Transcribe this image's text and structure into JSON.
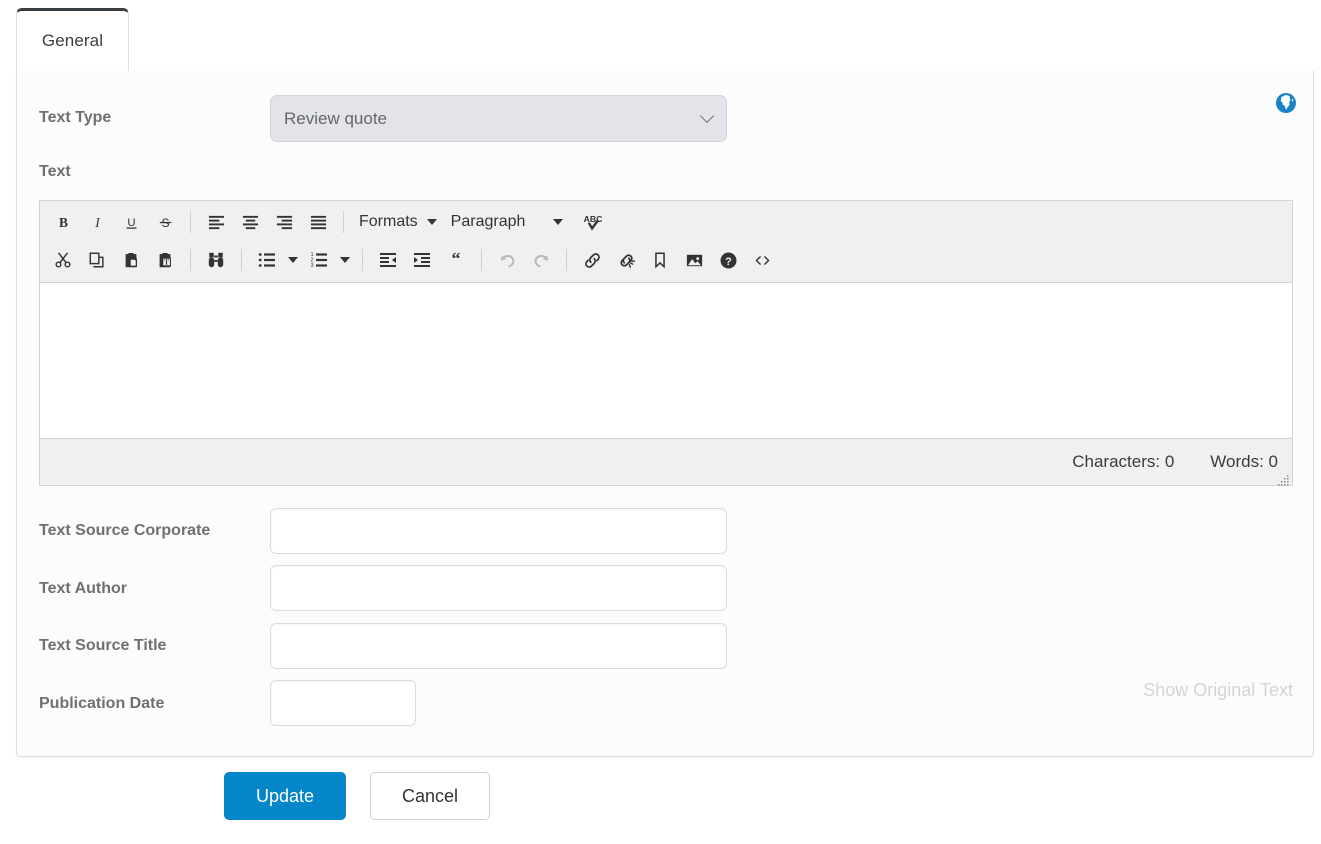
{
  "tabs": [
    {
      "id": "general",
      "label": "General",
      "active": true
    }
  ],
  "colors": {
    "accent": "#0586c8",
    "tab_active_top": "#3a3f44",
    "label": "#707070",
    "select_bg": "#e3e4ea",
    "toolbar_bg": "#f0f0f0",
    "muted_link": "#d4d4d4",
    "globe": "#1a83c6"
  },
  "form": {
    "text_type": {
      "label": "Text Type",
      "value": "Review quote",
      "icon": "chevron-down-icon"
    },
    "text": {
      "label": "Text"
    },
    "text_source_corporate": {
      "label": "Text Source Corporate",
      "value": "",
      "placeholder": ""
    },
    "text_author": {
      "label": "Text Author",
      "value": "",
      "placeholder": ""
    },
    "text_source_title": {
      "label": "Text Source Title",
      "value": "",
      "placeholder": ""
    },
    "publication_date": {
      "label": "Publication Date",
      "value": "",
      "placeholder": ""
    }
  },
  "language_button": {
    "icon": "globe-icon",
    "title": "Globe"
  },
  "editor": {
    "toolbar_row1": [
      {
        "name": "bold-icon",
        "label": "B",
        "kind": "icon"
      },
      {
        "name": "italic-icon",
        "label": "I",
        "kind": "icon"
      },
      {
        "name": "underline-icon",
        "label": "U",
        "kind": "icon"
      },
      {
        "name": "strikethrough-icon",
        "label": "S",
        "kind": "icon"
      },
      {
        "name": "separator",
        "kind": "sep"
      },
      {
        "name": "align-left-icon",
        "kind": "icon"
      },
      {
        "name": "align-center-icon",
        "kind": "icon"
      },
      {
        "name": "align-right-icon",
        "kind": "icon"
      },
      {
        "name": "align-justify-icon",
        "kind": "icon"
      },
      {
        "name": "separator",
        "kind": "sep"
      },
      {
        "name": "formats-menu",
        "label": "Formats",
        "kind": "menu"
      },
      {
        "name": "paragraph-menu",
        "label": "Paragraph",
        "kind": "menu"
      },
      {
        "name": "spellcheck-icon",
        "kind": "icon"
      }
    ],
    "toolbar_row2": [
      {
        "name": "cut-icon",
        "kind": "icon"
      },
      {
        "name": "copy-icon",
        "kind": "icon"
      },
      {
        "name": "paste-icon",
        "kind": "icon"
      },
      {
        "name": "paste-as-text-icon",
        "kind": "icon"
      },
      {
        "name": "separator",
        "kind": "sep"
      },
      {
        "name": "find-and-replace-icon",
        "kind": "icon"
      },
      {
        "name": "separator",
        "kind": "sep"
      },
      {
        "name": "bullet-list-icon",
        "kind": "icon"
      },
      {
        "name": "bullet-list-caret",
        "kind": "caret"
      },
      {
        "name": "numbered-list-icon",
        "kind": "icon"
      },
      {
        "name": "numbered-list-caret",
        "kind": "caret"
      },
      {
        "name": "separator",
        "kind": "sep"
      },
      {
        "name": "outdent-icon",
        "kind": "icon"
      },
      {
        "name": "indent-icon",
        "kind": "icon"
      },
      {
        "name": "blockquote-icon",
        "kind": "icon"
      },
      {
        "name": "separator",
        "kind": "sep"
      },
      {
        "name": "undo-icon",
        "kind": "icon",
        "disabled": true
      },
      {
        "name": "redo-icon",
        "kind": "icon",
        "disabled": true
      },
      {
        "name": "separator",
        "kind": "sep"
      },
      {
        "name": "insert-link-icon",
        "kind": "icon"
      },
      {
        "name": "unlink-icon",
        "kind": "icon"
      },
      {
        "name": "anchor-icon",
        "kind": "icon"
      },
      {
        "name": "insert-image-icon",
        "kind": "icon"
      },
      {
        "name": "help-icon",
        "kind": "icon"
      },
      {
        "name": "source-code-icon",
        "kind": "icon"
      }
    ],
    "formats_label": "Formats",
    "paragraph_label": "Paragraph",
    "content": "",
    "status": {
      "characters": "Characters: 0",
      "words": "Words: 0"
    }
  },
  "show_original_text": "Show Original Text",
  "footer": {
    "update_label": "Update",
    "cancel_label": "Cancel"
  }
}
